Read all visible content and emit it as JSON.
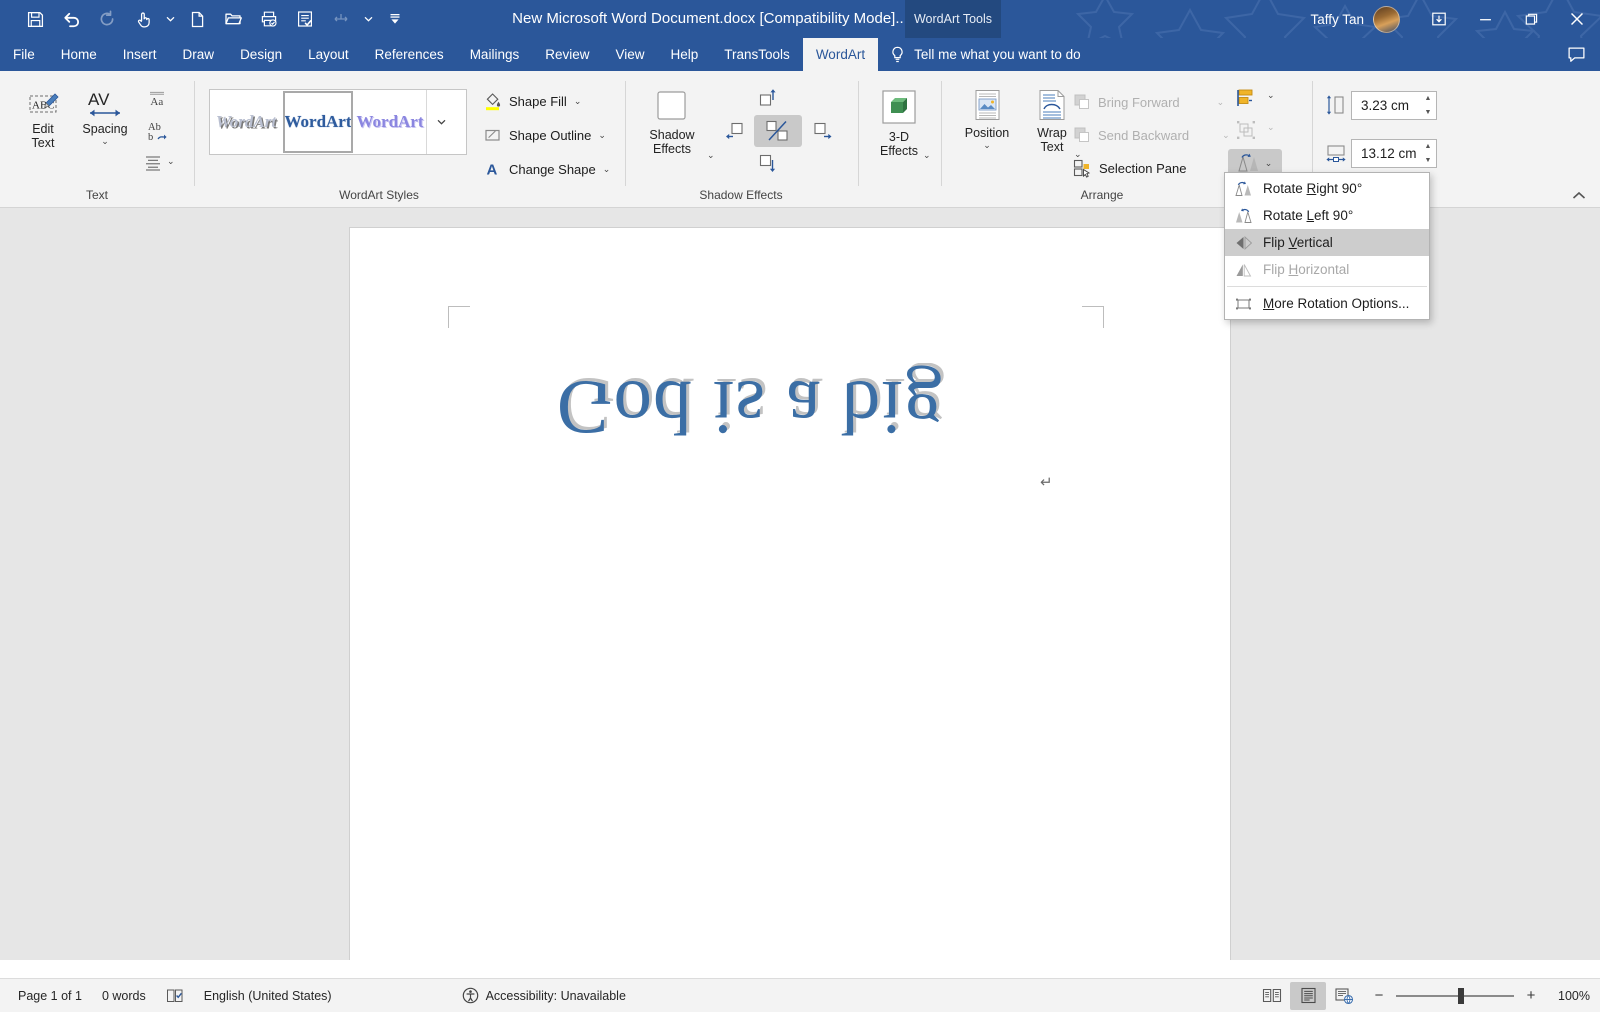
{
  "titlebar": {
    "document_title": "New Microsoft Word Document.docx [Compatibility Mode]...",
    "contextual_tools_label": "WordArt Tools",
    "account_name": "Taffy Tan",
    "quick_access": [
      {
        "name": "save-icon",
        "label": "Save",
        "disabled": false
      },
      {
        "name": "undo-icon",
        "label": "Undo",
        "disabled": false
      },
      {
        "name": "redo-icon",
        "label": "Redo",
        "disabled": true
      },
      {
        "name": "touch-mode-icon",
        "label": "Touch/Mouse Mode",
        "disabled": false
      },
      {
        "name": "new-document-icon",
        "label": "New",
        "disabled": false
      },
      {
        "name": "open-folder-icon",
        "label": "Open",
        "disabled": false
      },
      {
        "name": "print-preview-icon",
        "label": "Print Preview and Print",
        "disabled": false
      },
      {
        "name": "spelling-grammar-icon",
        "label": "Spelling & Grammar",
        "disabled": false
      },
      {
        "name": "insert-table-icon",
        "label": "Insert Table",
        "disabled": true
      },
      {
        "name": "customize-qat-icon",
        "label": "Customize Quick Access Toolbar",
        "disabled": false
      }
    ],
    "window_buttons": [
      {
        "name": "restore-ribbon-icon",
        "glyph": "⊞"
      },
      {
        "name": "minimize-button",
        "glyph": "–"
      },
      {
        "name": "restore-button",
        "glyph": "❐"
      },
      {
        "name": "close-button",
        "glyph": "✕"
      }
    ]
  },
  "tabs": [
    {
      "label": "File",
      "active": false
    },
    {
      "label": "Home",
      "active": false
    },
    {
      "label": "Insert",
      "active": false
    },
    {
      "label": "Draw",
      "active": false
    },
    {
      "label": "Design",
      "active": false
    },
    {
      "label": "Layout",
      "active": false
    },
    {
      "label": "References",
      "active": false
    },
    {
      "label": "Mailings",
      "active": false
    },
    {
      "label": "Review",
      "active": false
    },
    {
      "label": "View",
      "active": false
    },
    {
      "label": "Help",
      "active": false
    },
    {
      "label": "TransTools",
      "active": false
    },
    {
      "label": "WordArt",
      "active": true
    }
  ],
  "tell_me": {
    "placeholder": "Tell me what you want to do"
  },
  "ribbon": {
    "groups": [
      {
        "name": "text",
        "label": "Text"
      },
      {
        "name": "wordart-styles",
        "label": "WordArt Styles"
      },
      {
        "name": "shadow-effects",
        "label": "Shadow Effects"
      },
      {
        "name": "3d-effects",
        "label": ""
      },
      {
        "name": "arrange",
        "label": "Arrange"
      }
    ],
    "text_group": {
      "edit_text": "Edit\nText",
      "edit_text_line1": "Edit",
      "edit_text_line2": "Text",
      "spacing": "Spacing",
      "even_height_tip": "WordArt Same Letter Heights",
      "vertical_text_tip": "WordArt Vertical Text",
      "alignment_tip": "WordArt Alignment"
    },
    "wordart_styles": {
      "items": [
        {
          "label": "WordArt",
          "style": "wa1",
          "selected": false
        },
        {
          "label": "WordArt",
          "style": "wa2",
          "selected": true
        },
        {
          "label": "WordArt",
          "style": "wa3",
          "selected": false
        }
      ],
      "more_tip": "More"
    },
    "shape_group": {
      "shape_fill": "Shape Fill",
      "shape_outline": "Shape Outline",
      "change_shape": "Change Shape"
    },
    "shadow_group": {
      "shadow_effects_line1": "Shadow",
      "shadow_effects_line2": "Effects",
      "nudge_up": "Nudge Shadow Up",
      "nudge_left": "Nudge Shadow Left",
      "nudge_toggle": "Shadow On/Off",
      "nudge_right": "Nudge Shadow Right",
      "nudge_down": "Nudge Shadow Down"
    },
    "effects3d_group": {
      "line1": "3-D",
      "line2": "Effects"
    },
    "arrange_group": {
      "position_label": "Position",
      "wrap_text_line1": "Wrap",
      "wrap_text_line2": "Text",
      "bring_forward": "Bring Forward",
      "send_backward": "Send Backward",
      "selection_pane": "Selection Pane",
      "align_tip": "Align",
      "group_tip": "Group",
      "rotate_tip": "Rotate"
    },
    "size_group": {
      "height_value": "3.23 cm",
      "width_value": "13.12 cm",
      "height_tip": "Shape Height",
      "width_tip": "Shape Width"
    },
    "collapse_tip": "Collapse the Ribbon"
  },
  "rotate_menu": {
    "items": [
      {
        "label_pre": "Rotate ",
        "accel": "R",
        "label_post": "ight 90°",
        "icon": "rotate-right-icon",
        "state": "normal"
      },
      {
        "label_pre": "Rotate ",
        "accel": "L",
        "label_post": "eft 90°",
        "icon": "rotate-left-icon",
        "state": "normal"
      },
      {
        "label_pre": "Flip ",
        "accel": "V",
        "label_post": "ertical",
        "icon": "flip-vertical-icon",
        "state": "highlighted"
      },
      {
        "label_pre": "Flip ",
        "accel": "H",
        "label_post": "orizontal",
        "icon": "flip-horizontal-icon",
        "state": "normal"
      },
      {
        "label_pre": "",
        "accel": "M",
        "label_post": "ore Rotation Options...",
        "icon": "more-rotation-icon",
        "state": "normal"
      }
    ]
  },
  "document": {
    "wordart_text": "God is a big",
    "paragraph_mark": "↵"
  },
  "status_bar": {
    "page_info": "Page 1 of 1",
    "word_count": "0 words",
    "proofing_tip": "Proofing errors",
    "language": "English (United States)",
    "accessibility": "Accessibility: Unavailable",
    "views": [
      {
        "name": "read-mode-view-button",
        "tip": "Read Mode",
        "active": false
      },
      {
        "name": "print-layout-view-button",
        "tip": "Print Layout",
        "active": true
      },
      {
        "name": "web-layout-view-button",
        "tip": "Web Layout",
        "active": false
      }
    ],
    "zoom_out": "−",
    "zoom_in": "+",
    "zoom_level": "100%"
  },
  "colors": {
    "title_bar": "#2b579a",
    "ribbon_bg": "#f3f3f3",
    "accent_blue": "#2b579a",
    "wordart_fill": "#3b6ea5",
    "wordart_shadow": "#c3c3c3",
    "menu_highlight": "#cdcdcd",
    "page_bg": "#e6e6e6"
  }
}
